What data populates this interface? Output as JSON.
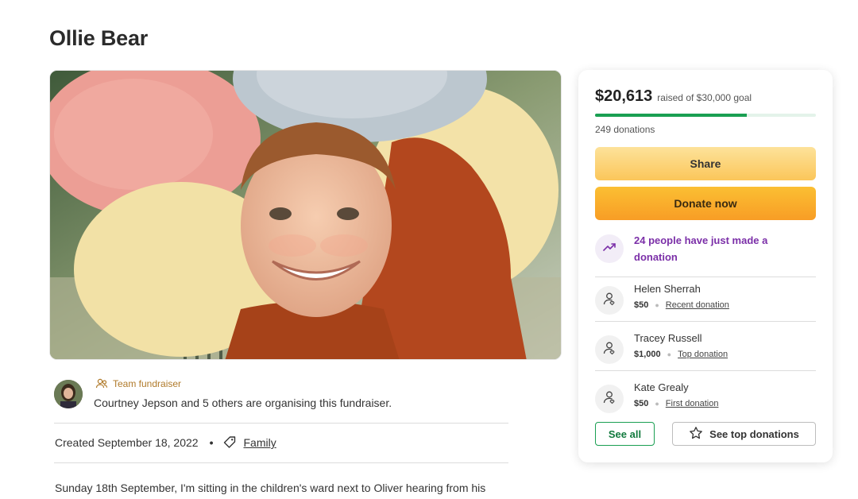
{
  "page": {
    "title": "Ollie Bear"
  },
  "organiser": {
    "team_label": "Team fundraiser",
    "text": "Courtney Jepson and 5 others are organising this fundraiser."
  },
  "meta": {
    "created": "Created September 18, 2022",
    "separator": "•",
    "category": "Family"
  },
  "story": {
    "excerpt": "Sunday 18th September, I'm sitting in the children's ward next to Oliver hearing from his"
  },
  "donation_card": {
    "amount_raised": "$20,613",
    "goal_text": "raised of $30,000 goal",
    "progress_fraction": 0.687,
    "donations_count": "249 donations",
    "share_label": "Share",
    "donate_label": "Donate now",
    "trend_text": "24 people have just made a donation",
    "donors": [
      {
        "name": "Helen Sherrah",
        "amount": "$50",
        "type": "Recent donation"
      },
      {
        "name": "Tracey Russell",
        "amount": "$1,000",
        "type": "Top donation"
      },
      {
        "name": "Kate Grealy",
        "amount": "$50",
        "type": "First donation"
      }
    ],
    "see_all_label": "See all",
    "see_top_label": "See top donations"
  },
  "colors": {
    "accent_green": "#1a9f52",
    "donate_orange": "#f89d25",
    "share_yellow": "#fbc65a",
    "trend_purple": "#7b2fa8"
  },
  "icons": [
    "team-icon",
    "tag-icon",
    "trend-up-icon",
    "donor-icon",
    "star-icon"
  ]
}
